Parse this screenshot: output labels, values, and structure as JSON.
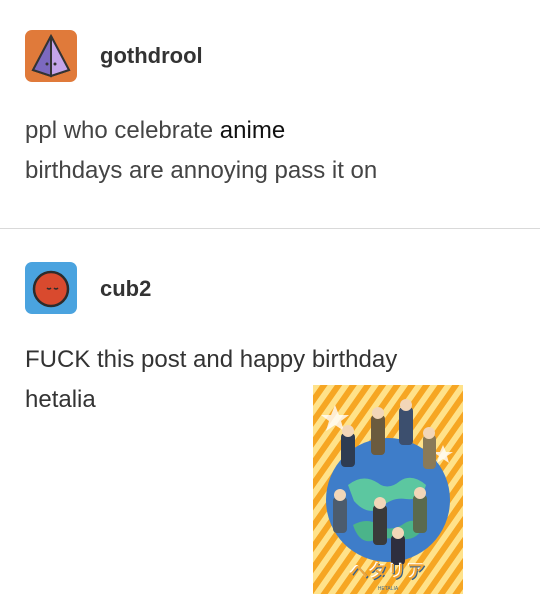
{
  "posts": [
    {
      "username": "gothdrool",
      "avatar_icon": "pyramid-avatar-icon",
      "body_lines": [
        "ppl who celebrate ",
        "anime",
        "birthdays are annoying pass it on"
      ]
    },
    {
      "username": "cub2",
      "avatar_icon": "moon-face-avatar-icon",
      "body_lines": [
        "FUCK this post and happy birthday",
        "hetalia"
      ],
      "image": {
        "icon": "hetalia-poster-image",
        "title_text": "ヘタリア",
        "small_print": "HETALIA"
      }
    }
  ],
  "colors": {
    "avatar1_bg": "#e07a3a",
    "avatar2_bg": "#4aa3df",
    "divider": "#d9d9d9"
  }
}
